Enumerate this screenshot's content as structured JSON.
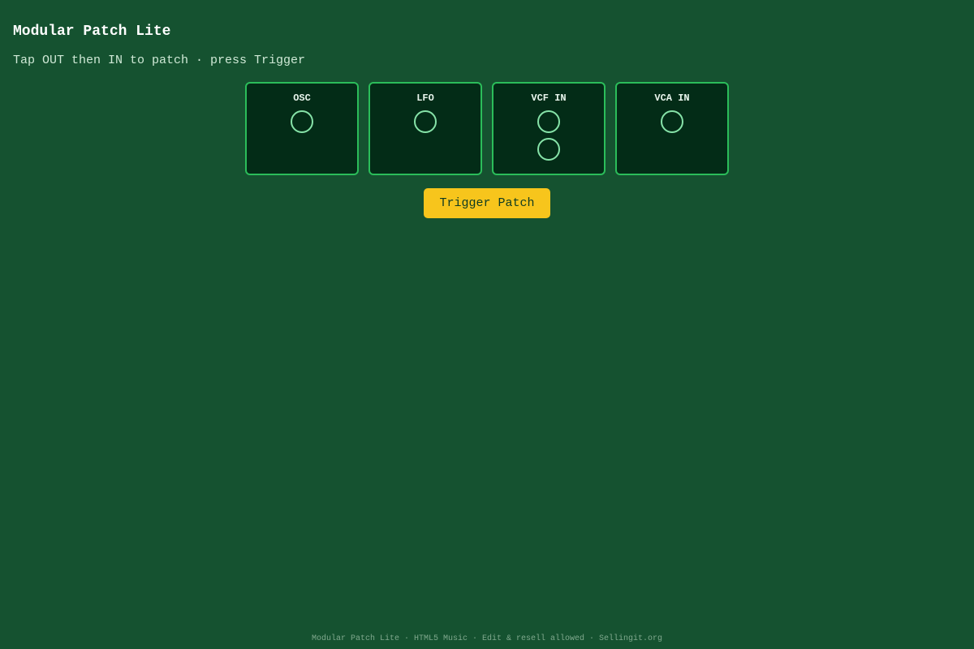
{
  "header": {
    "title": "Modular Patch Lite",
    "subtitle": "Tap OUT then IN to patch · press Trigger"
  },
  "modules": [
    {
      "label": "OSC",
      "jacks": 1
    },
    {
      "label": "LFO",
      "jacks": 1
    },
    {
      "label": "VCF IN",
      "jacks": 2
    },
    {
      "label": "VCA IN",
      "jacks": 1
    }
  ],
  "controls": {
    "trigger_label": "Trigger Patch"
  },
  "footer": {
    "text": "Modular Patch Lite · HTML5 Music · Edit & resell allowed · Sellingit.org"
  },
  "colors": {
    "background": "#155230",
    "module_bg": "#032c17",
    "module_border": "#2bbd5a",
    "jack_ring": "#86e3a8",
    "trigger_button": "#f7c51c"
  }
}
